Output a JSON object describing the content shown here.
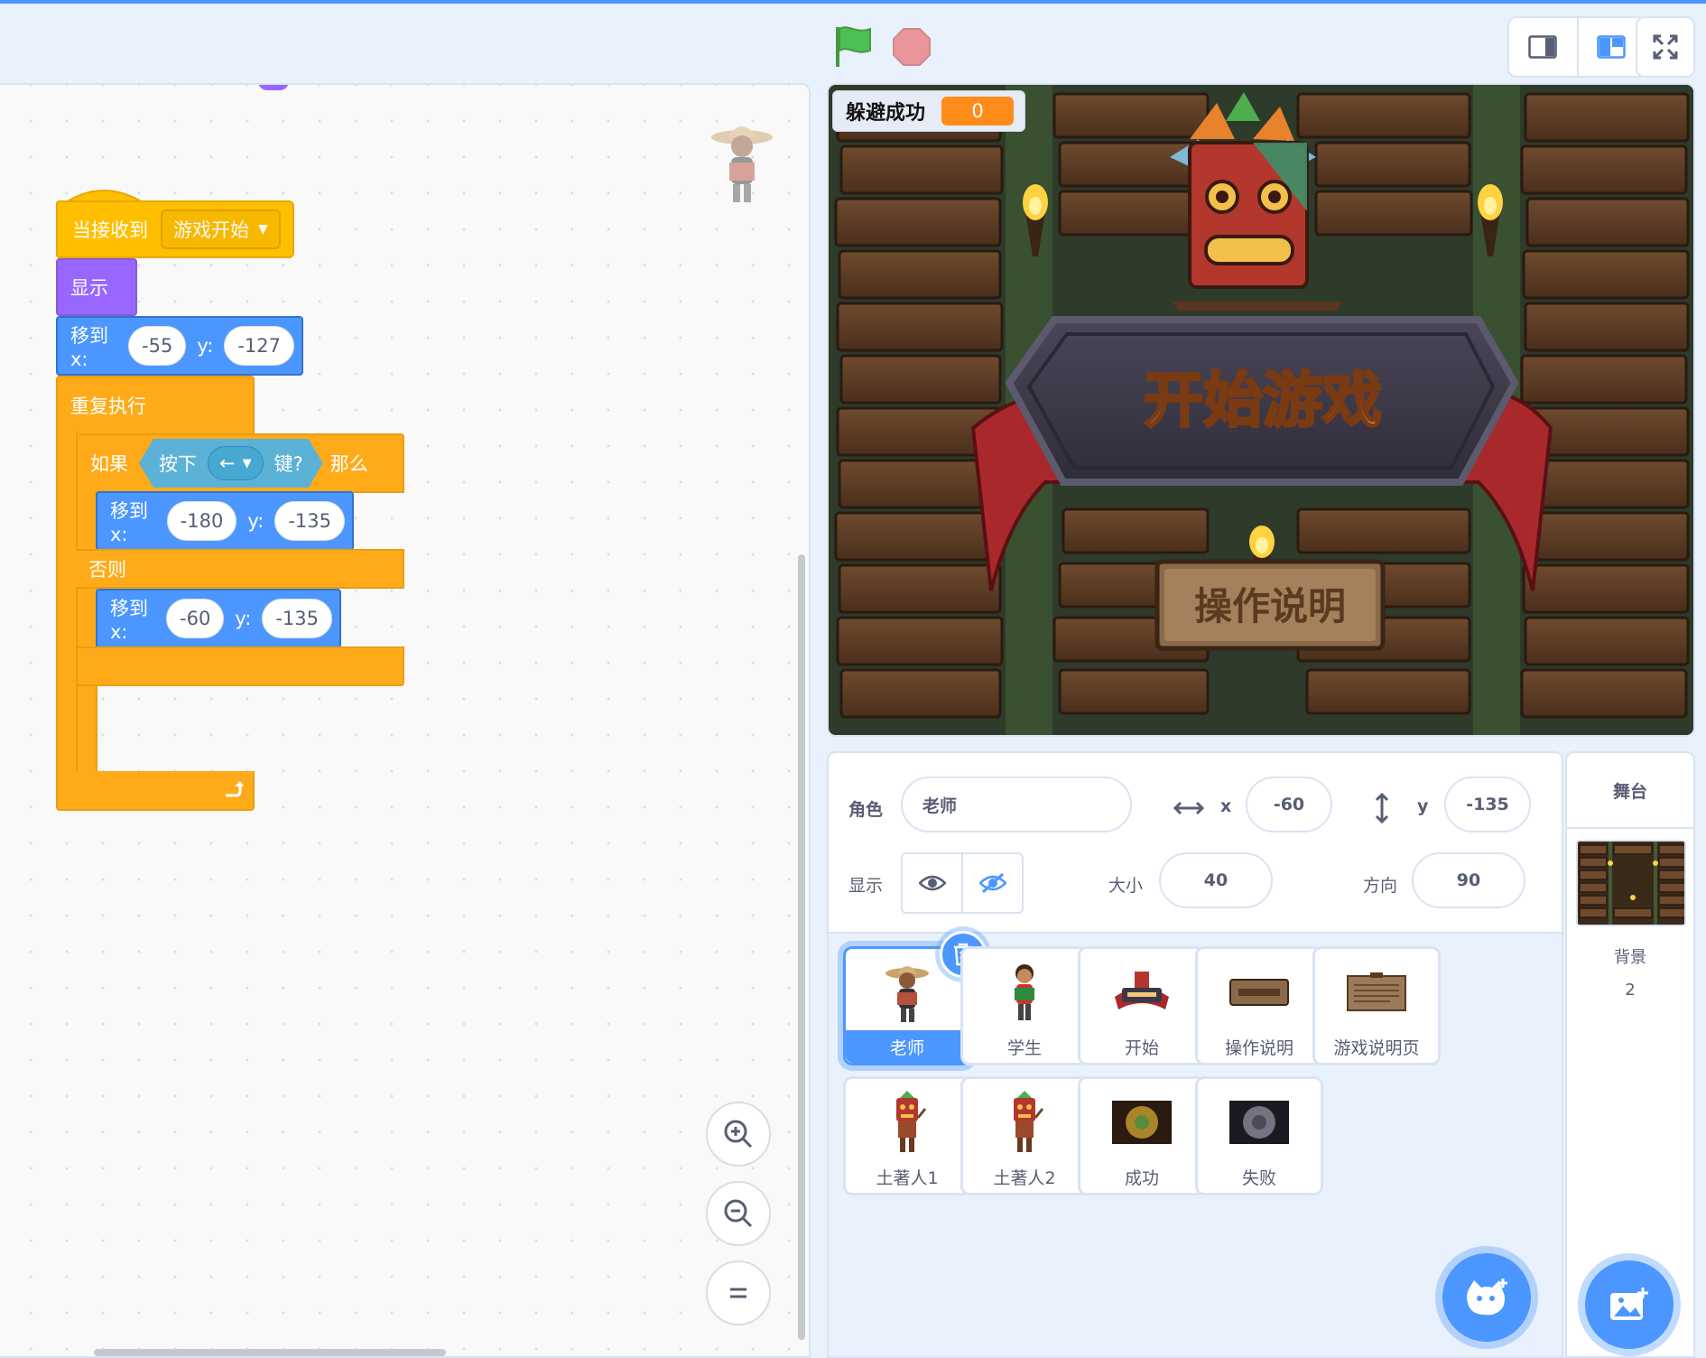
{
  "colors": {
    "motion": "#4c97ff",
    "looks": "#9966ff",
    "events": "#ffbf00",
    "control": "#ffab19",
    "sensing": "#5cb1d6",
    "accent": "#4c97ff",
    "monitor_value": "#ff8c1a"
  },
  "toolbar": {
    "flag_icon": "green-flag-icon",
    "stop_icon": "stop-icon"
  },
  "script": {
    "when_receive": "当接收到",
    "message": "游戏开始",
    "show": "显示",
    "goto1": {
      "label": "移到 x:",
      "x": "-55",
      "ylabel": "y:",
      "y": "-127"
    },
    "forever": "重复执行",
    "if": "如果",
    "key_pressed": "按下",
    "key": "←",
    "key_q": "键?",
    "then": "那么",
    "goto2": {
      "label": "移到 x:",
      "x": "-180",
      "ylabel": "y:",
      "y": "-135"
    },
    "else": "否则",
    "goto3": {
      "label": "移到 x:",
      "x": "-60",
      "ylabel": "y:",
      "y": "-135"
    }
  },
  "monitor": {
    "label": "躲避成功",
    "value": "0"
  },
  "stage_art": {
    "title": "开始游戏",
    "button": "操作说明"
  },
  "sprite_info": {
    "sprite_label": "角色",
    "sprite_name": "老师",
    "x_label": "x",
    "x": "-60",
    "y_label": "y",
    "y": "-135",
    "show_label": "显示",
    "size_label": "大小",
    "size": "40",
    "direction_label": "方向",
    "direction": "90"
  },
  "sprites": [
    {
      "name": "老师",
      "selected": true
    },
    {
      "name": "学生"
    },
    {
      "name": "开始"
    },
    {
      "name": "操作说明"
    },
    {
      "name": "游戏说明页"
    },
    {
      "name": "土著人1"
    },
    {
      "name": "土著人2"
    },
    {
      "name": "成功"
    },
    {
      "name": "失败"
    }
  ],
  "stage_panel": {
    "title": "舞台",
    "backdrops_label": "背景",
    "backdrops_count": "2"
  }
}
